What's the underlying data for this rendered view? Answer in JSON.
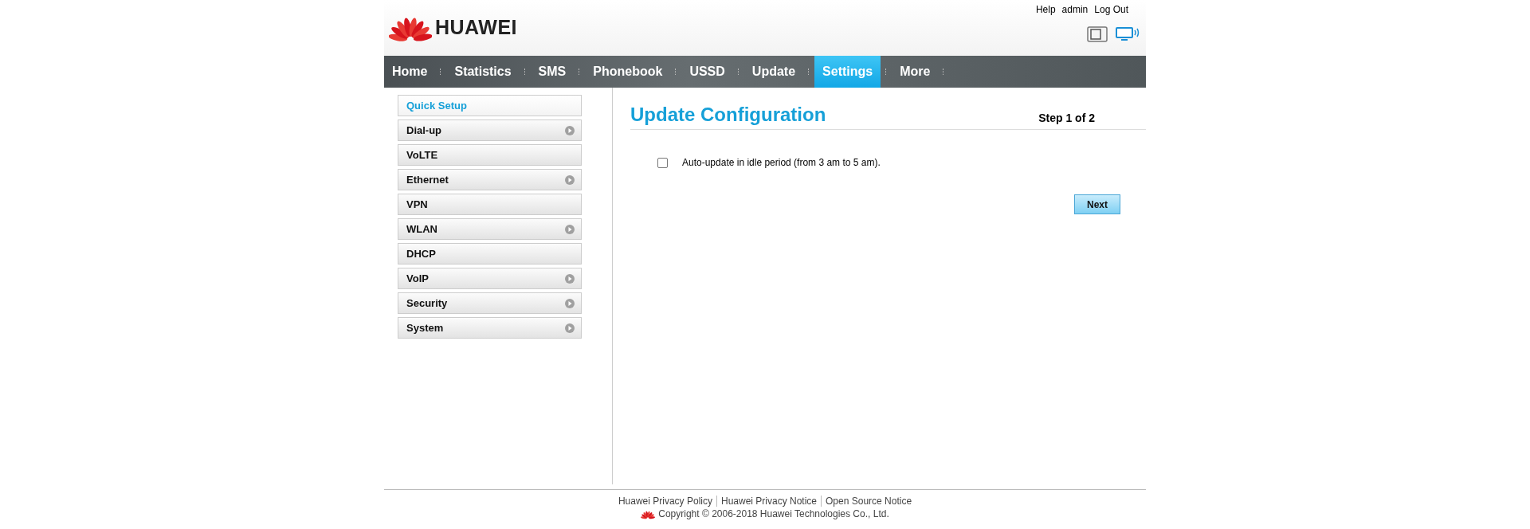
{
  "header": {
    "brand": "HUAWEI",
    "links": [
      "Help",
      "admin",
      "Log Out"
    ]
  },
  "nav": [
    {
      "label": "Home",
      "selected": false
    },
    {
      "label": "Statistics",
      "selected": false
    },
    {
      "label": "SMS",
      "selected": false
    },
    {
      "label": "Phonebook",
      "selected": false
    },
    {
      "label": "USSD",
      "selected": false
    },
    {
      "label": "Update",
      "selected": false
    },
    {
      "label": "Settings",
      "selected": true
    },
    {
      "label": "More",
      "selected": false
    }
  ],
  "sidebar": {
    "items": [
      {
        "label": "Quick Setup",
        "selected": true,
        "expandable": false
      },
      {
        "label": "Dial-up",
        "selected": false,
        "expandable": true
      },
      {
        "label": "VoLTE",
        "selected": false,
        "expandable": false
      },
      {
        "label": "Ethernet",
        "selected": false,
        "expandable": true
      },
      {
        "label": "VPN",
        "selected": false,
        "expandable": false
      },
      {
        "label": "WLAN",
        "selected": false,
        "expandable": true
      },
      {
        "label": "DHCP",
        "selected": false,
        "expandable": false
      },
      {
        "label": "VoIP",
        "selected": false,
        "expandable": true
      },
      {
        "label": "Security",
        "selected": false,
        "expandable": true
      },
      {
        "label": "System",
        "selected": false,
        "expandable": true
      }
    ]
  },
  "content": {
    "title": "Update Configuration",
    "step": "Step 1 of 2",
    "option": {
      "label": "Auto-update in idle period (from 3 am to 5 am).",
      "checked": false
    },
    "button": "Next"
  },
  "footer": {
    "links": [
      "Huawei Privacy Policy",
      "Huawei Privacy Notice",
      "Open Source Notice"
    ],
    "copyright": "Copyright © 2006-2018 Huawei Technologies Co., Ltd."
  }
}
